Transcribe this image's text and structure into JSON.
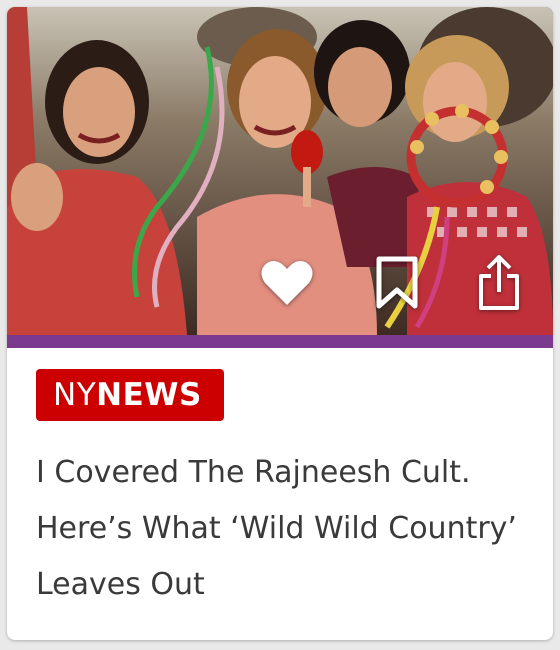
{
  "card": {
    "image_alt": "",
    "accent_color": "#7c3a8f",
    "actions": {
      "like": {
        "icon": "heart-icon"
      },
      "save": {
        "icon": "bookmark-icon"
      },
      "share": {
        "icon": "share-icon"
      }
    },
    "badge": {
      "prefix": "NY",
      "suffix": "NEWS",
      "color": "#cc0000"
    },
    "headline": "I Covered The Rajneesh Cult. Here’s What ‘Wild Wild Country’ Leaves Out"
  }
}
